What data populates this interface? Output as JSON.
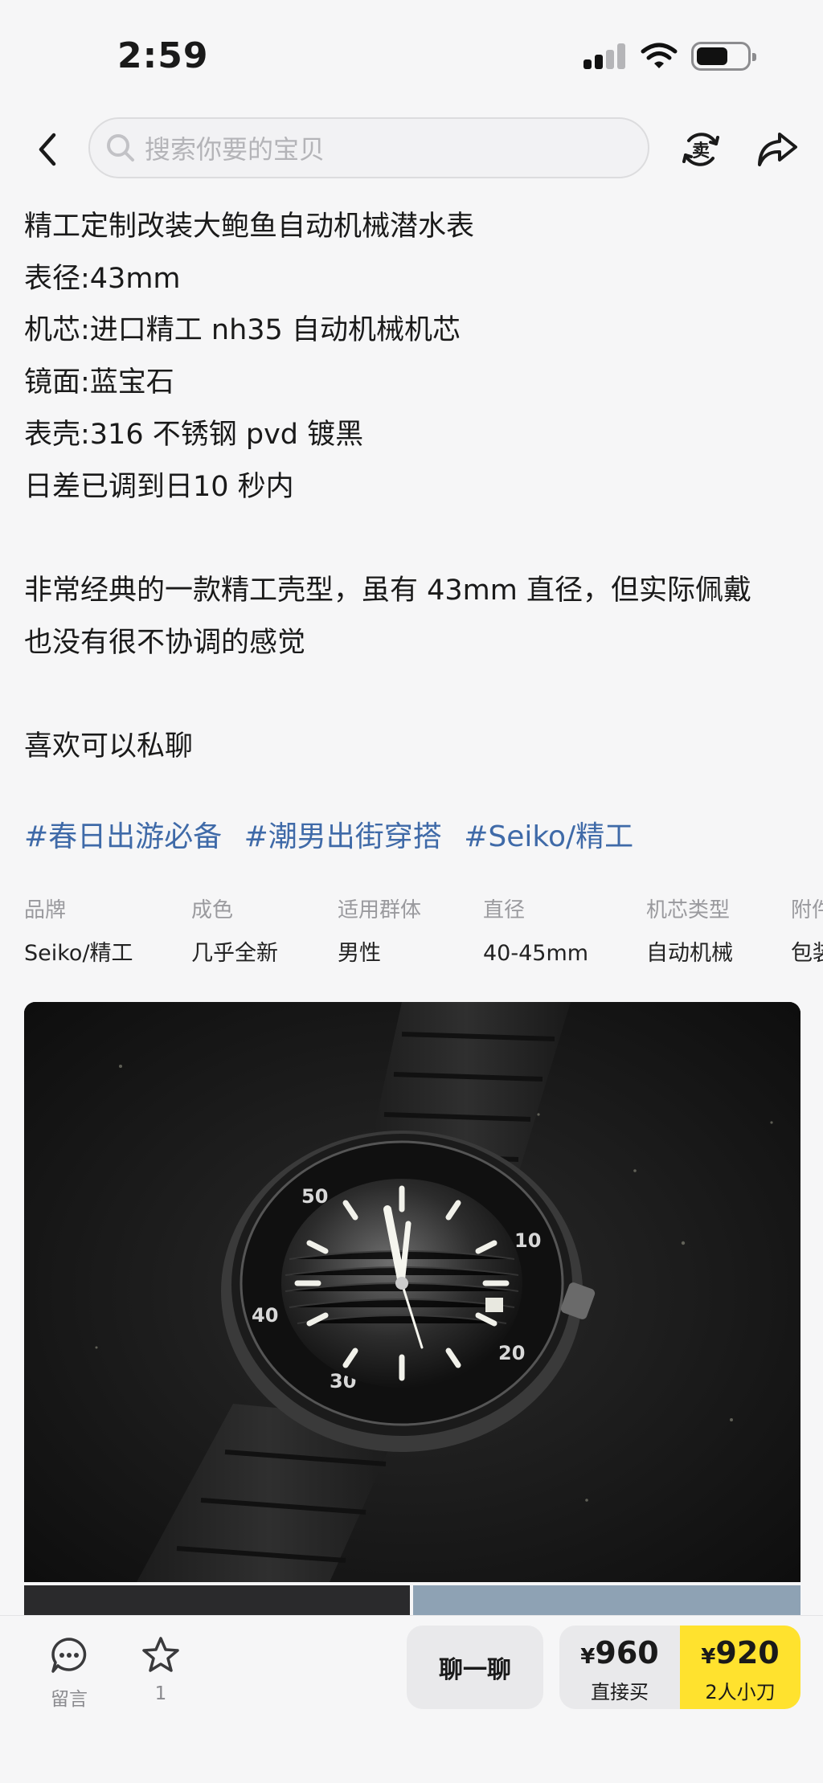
{
  "status_bar": {
    "time": "2:59"
  },
  "search": {
    "placeholder": "搜索你要的宝贝"
  },
  "description": {
    "lines": [
      "精工定制改装大鲍鱼自动机械潜水表",
      "表径:43mm",
      "机芯:进口精工 nh35 自动机械机芯",
      "镜面:蓝宝石",
      "表壳:316 不锈钢 pvd 镀黑",
      "日差已调到日10 秒内",
      "",
      "非常经典的一款精工壳型，虽有 43mm 直径，但实际佩戴",
      "也没有很不协调的感觉",
      "",
      "喜欢可以私聊"
    ]
  },
  "tags": [
    "#春日出游必备",
    "#潮男出街穿搭",
    "#Seiko/精工"
  ],
  "attributes": [
    {
      "label": "品牌",
      "value": "Seiko/精工"
    },
    {
      "label": "成色",
      "value": "几乎全新"
    },
    {
      "label": "适用群体",
      "value": "男性"
    },
    {
      "label": "直径",
      "value": "40-45mm"
    },
    {
      "label": "机芯类型",
      "value": "自动机械"
    },
    {
      "label": "附件",
      "value": "包装"
    }
  ],
  "bottom_bar": {
    "message_label": "留言",
    "favorite_count": "1",
    "chat_label": "聊一聊",
    "buy_price": "960",
    "buy_label": "直接买",
    "bargain_price": "920",
    "bargain_label": "2人小刀",
    "currency": "¥"
  },
  "colors": {
    "tag": "#3f6aa8",
    "bargain_bg": "#ffe22e",
    "background": "#f6f6f7"
  },
  "icons": [
    "back-icon",
    "search-icon",
    "sell-icon",
    "share-icon",
    "message-icon",
    "star-icon"
  ]
}
